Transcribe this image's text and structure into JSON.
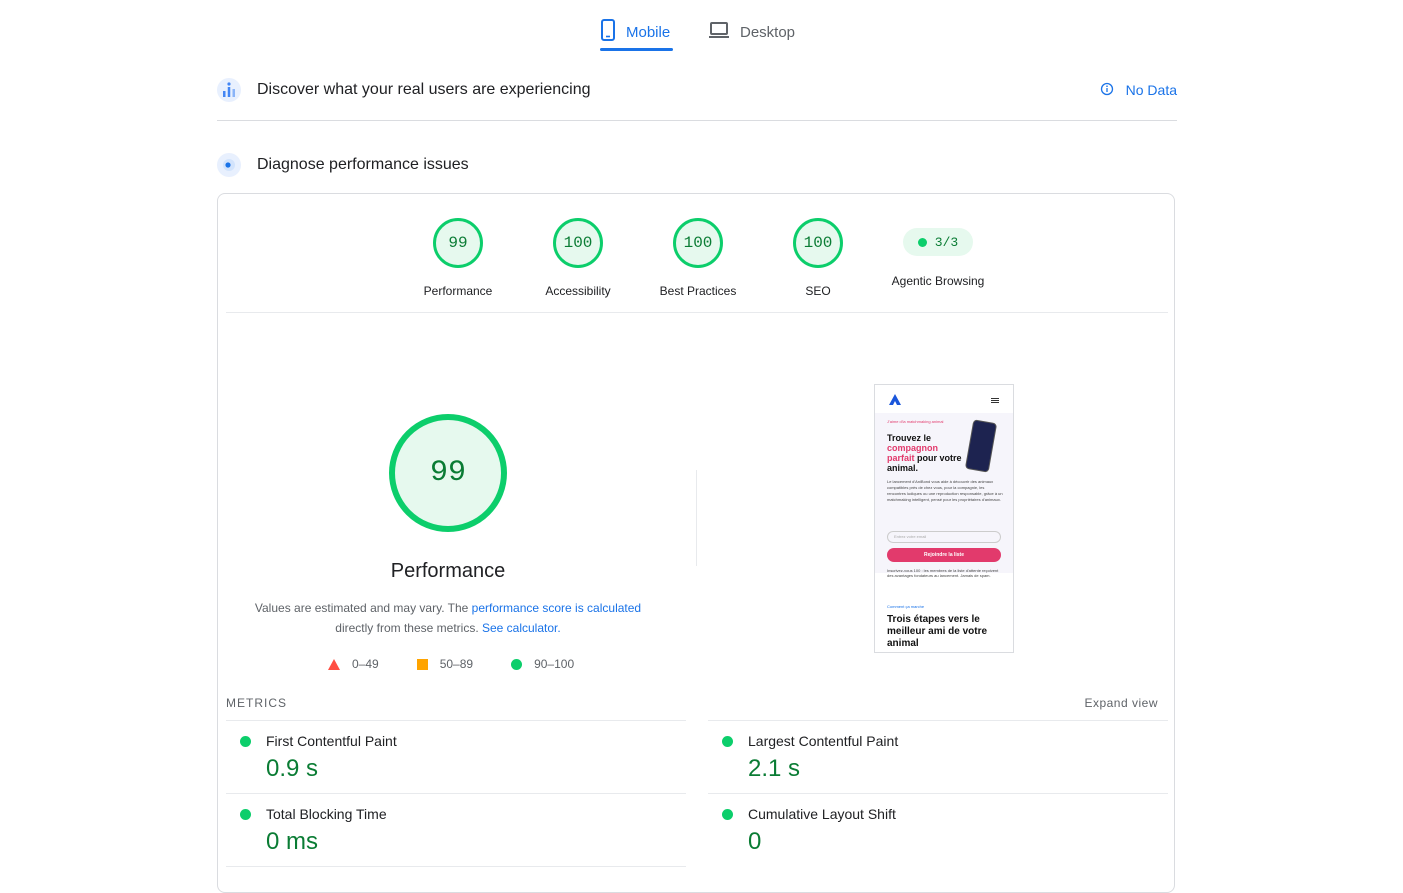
{
  "tabs": [
    {
      "label": "Mobile",
      "icon": "smartphone-icon",
      "active": true
    },
    {
      "label": "Desktop",
      "icon": "laptop-icon",
      "active": false
    }
  ],
  "field_data": {
    "title": "Discover what your real users are experiencing",
    "status": "No Data"
  },
  "diagnose": {
    "title": "Diagnose performance issues"
  },
  "scores": [
    {
      "label": "Performance",
      "value": "99"
    },
    {
      "label": "Accessibility",
      "value": "100"
    },
    {
      "label": "Best Practices",
      "value": "100"
    },
    {
      "label": "SEO",
      "value": "100"
    }
  ],
  "agentic": {
    "label": "Agentic Browsing",
    "value": "3/3"
  },
  "performance": {
    "score": "99",
    "title": "Performance",
    "desc_prefix": "Values are estimated and may vary. The ",
    "desc_link1": "performance score is calculated",
    "desc_middle": " directly from these metrics. ",
    "desc_link2": "See calculator."
  },
  "legend": [
    {
      "shape": "triangle",
      "label": "0–49",
      "color": "#ff4e42"
    },
    {
      "shape": "square",
      "label": "50–89",
      "color": "#ffa400"
    },
    {
      "shape": "circle",
      "label": "90–100",
      "color": "#0cce6b"
    }
  ],
  "preview": {
    "tagline": "J'aime d'la matchmaking animal",
    "h1_part1": "Trouvez le ",
    "h1_pink": "compagnon parfait",
    "h1_part2": " pour votre animal.",
    "para": "Le lancement d'AniBond vous aide à découvrir des animaux compatibles près de chez vous, pour la compagnie, les rencontres ludiques ou une reproduction responsable, grâce à un matchmaking intelligent, pensé pour les propriétaires d'animaux.",
    "input_placeholder": "Entrez votre email",
    "button": "Rejoindre la liste",
    "small": "Inscrivez-vous 100 : les membres de la liste d'attente reçoivent des avantages fondateurs au lancement. Jamais de spam.",
    "kicker": "Comment ça marche",
    "h2": "Trois étapes vers le meilleur ami de votre animal"
  },
  "metrics": {
    "title": "METRICS",
    "expand": "Expand view",
    "items": [
      {
        "name": "First Contentful Paint",
        "value": "0.9 s"
      },
      {
        "name": "Largest Contentful Paint",
        "value": "2.1 s"
      },
      {
        "name": "Total Blocking Time",
        "value": "0 ms"
      },
      {
        "name": "Cumulative Layout Shift",
        "value": "0"
      }
    ]
  },
  "colors": {
    "accent": "#1a73e8",
    "pass": "#0cce6b",
    "pass_text": "#0a7c34",
    "pink": "#e23a6c"
  }
}
